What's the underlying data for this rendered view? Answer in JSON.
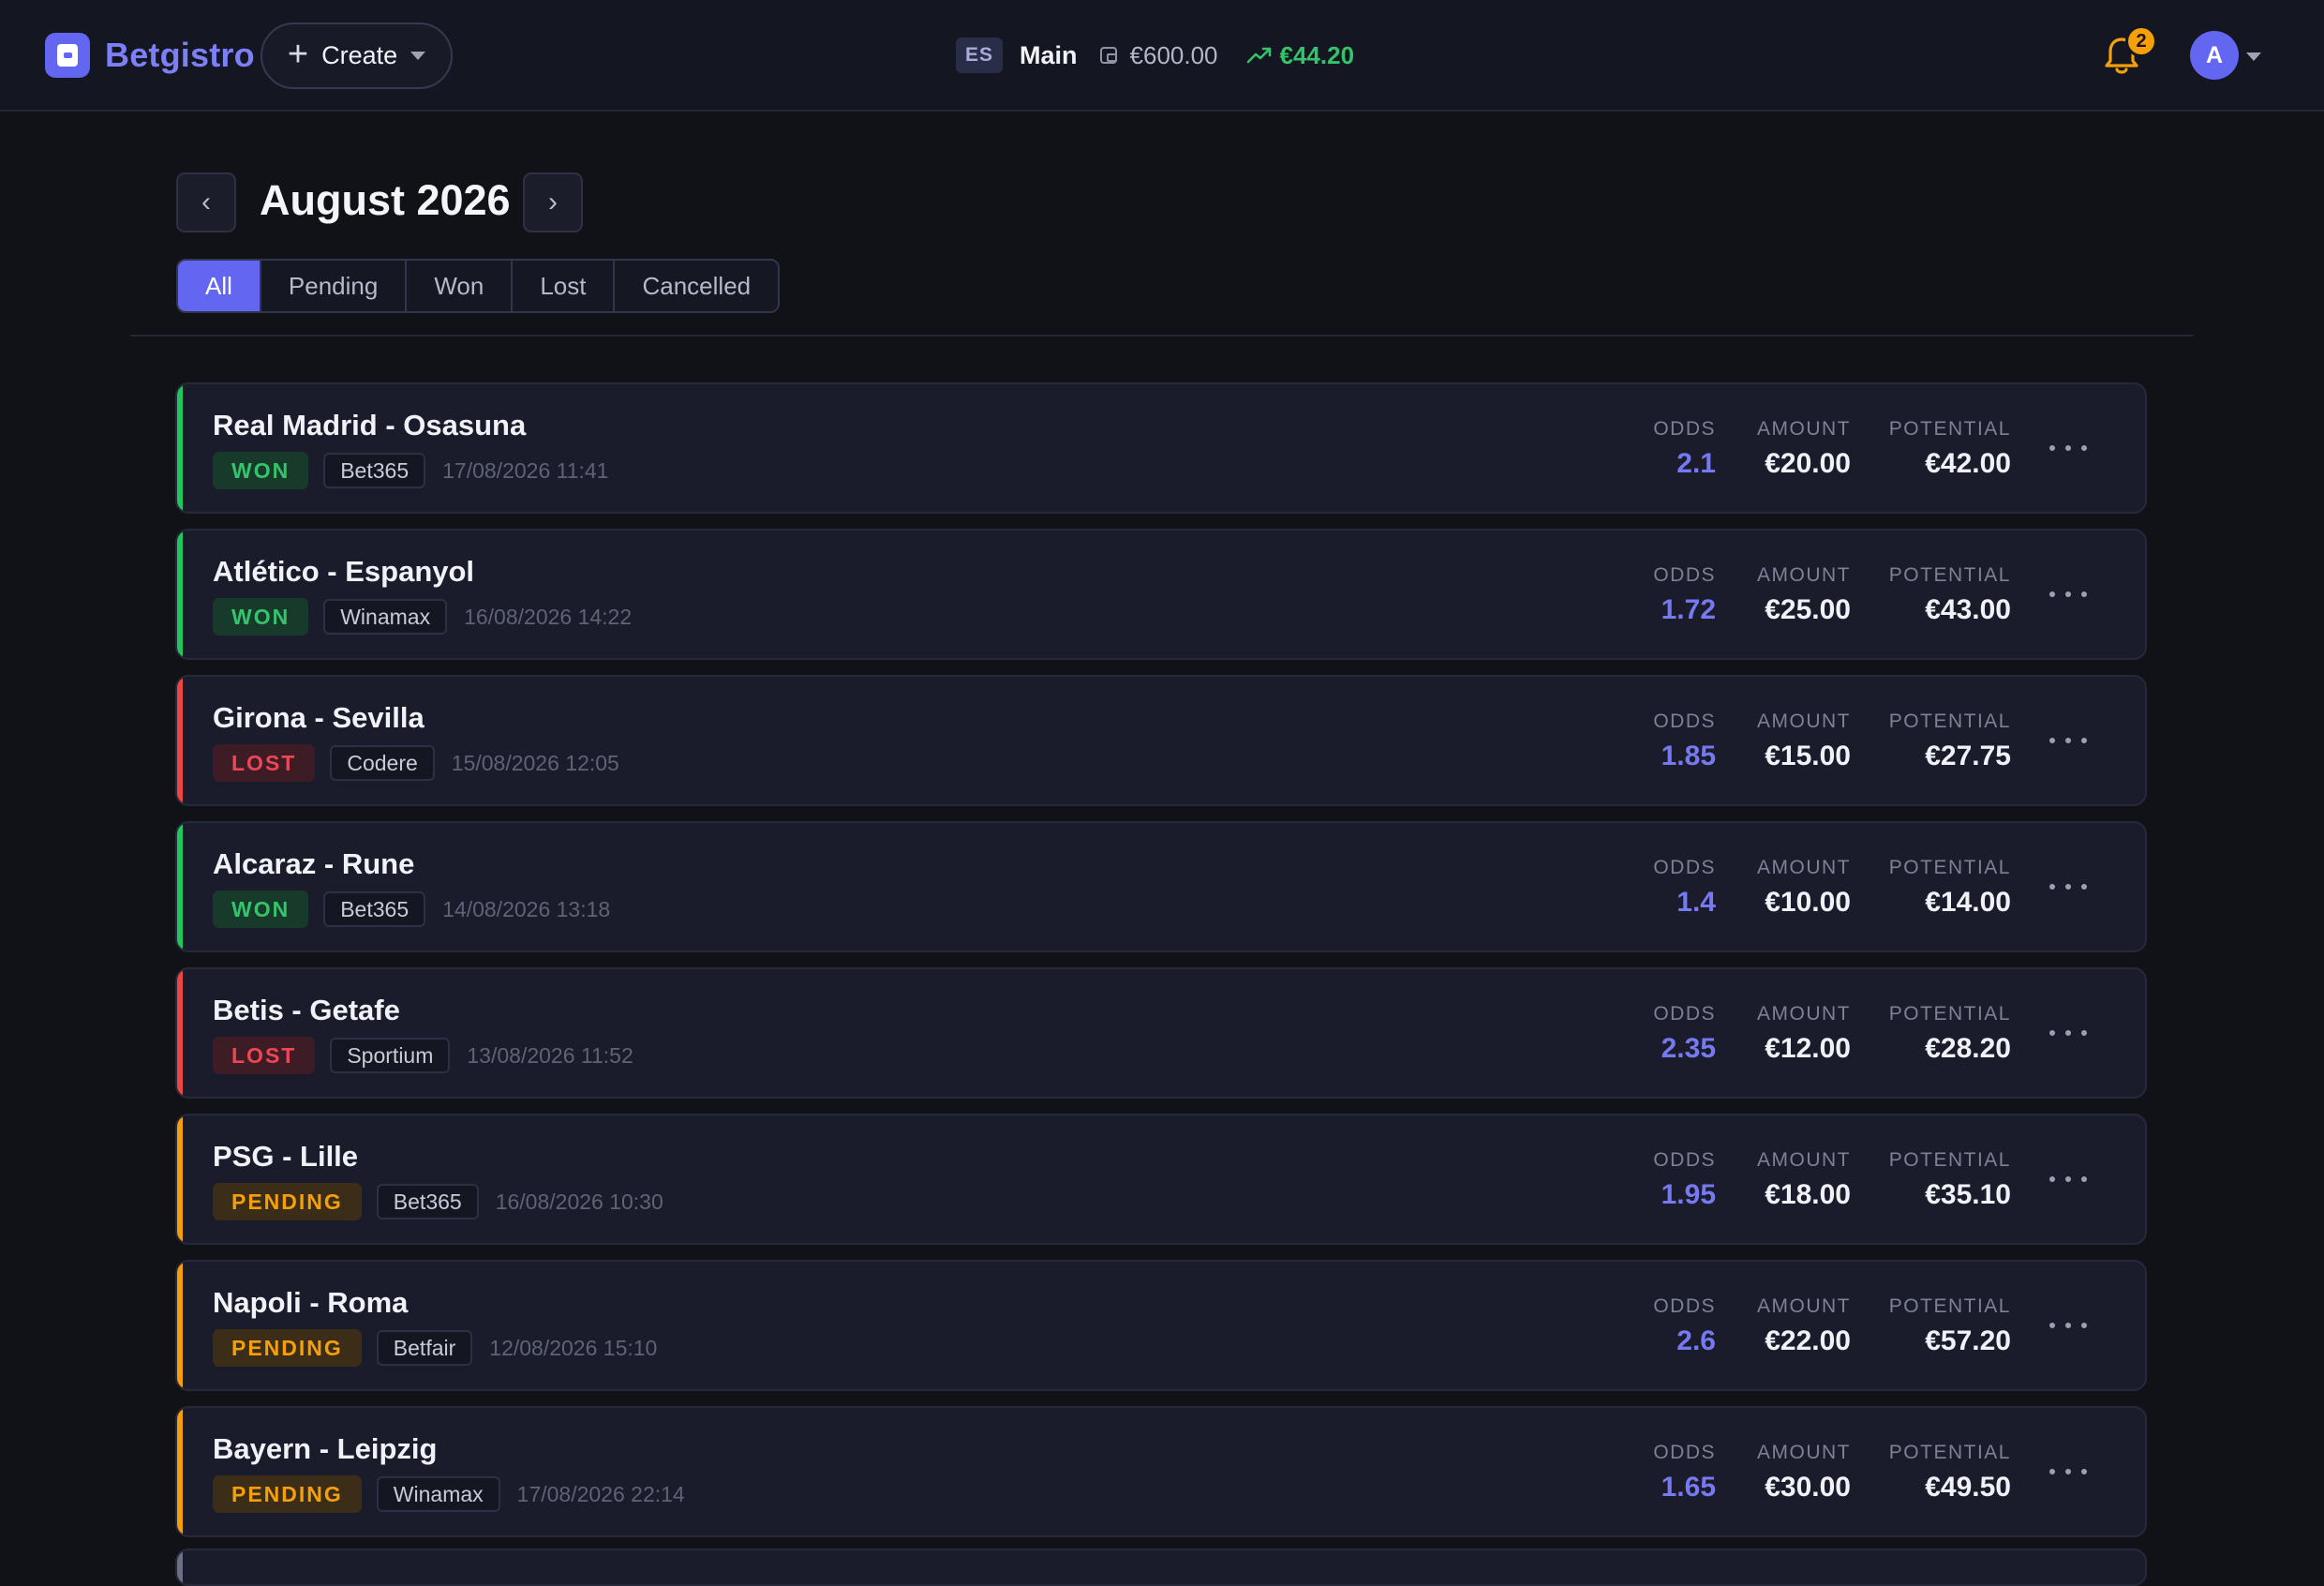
{
  "header": {
    "brand": "Betgistro",
    "create_label": "Create",
    "account_flag": "ES",
    "account_name": "Main",
    "balance": "€600.00",
    "profit": "€44.20",
    "notifications": "2",
    "avatar_initial": "A"
  },
  "month": {
    "title": "August 2026",
    "prev_symbol": "‹",
    "next_symbol": "›"
  },
  "filters": [
    "All",
    "Pending",
    "Won",
    "Lost",
    "Cancelled"
  ],
  "columns": {
    "odds": "ODDS",
    "amount": "AMOUNT",
    "potential": "POTENTIAL"
  },
  "colors": {
    "won": "#22c55e",
    "lost": "#ef4444",
    "pending": "#f59e0b",
    "accent": "#6366f1"
  },
  "bets": [
    {
      "event": "Real Madrid - Osasuna",
      "status": "WON",
      "bookmaker": "Bet365",
      "date": "17/08/2026 11:41",
      "odds": "2.1",
      "amount": "€20.00",
      "potential": "€42.00"
    },
    {
      "event": "Atlético - Espanyol",
      "status": "WON",
      "bookmaker": "Winamax",
      "date": "16/08/2026 14:22",
      "odds": "1.72",
      "amount": "€25.00",
      "potential": "€43.00"
    },
    {
      "event": "Girona - Sevilla",
      "status": "LOST",
      "bookmaker": "Codere",
      "date": "15/08/2026 12:05",
      "odds": "1.85",
      "amount": "€15.00",
      "potential": "€27.75"
    },
    {
      "event": "Alcaraz - Rune",
      "status": "WON",
      "bookmaker": "Bet365",
      "date": "14/08/2026 13:18",
      "odds": "1.4",
      "amount": "€10.00",
      "potential": "€14.00"
    },
    {
      "event": "Betis - Getafe",
      "status": "LOST",
      "bookmaker": "Sportium",
      "date": "13/08/2026 11:52",
      "odds": "2.35",
      "amount": "€12.00",
      "potential": "€28.20"
    },
    {
      "event": "PSG - Lille",
      "status": "PENDING",
      "bookmaker": "Bet365",
      "date": "16/08/2026 10:30",
      "odds": "1.95",
      "amount": "€18.00",
      "potential": "€35.10"
    },
    {
      "event": "Napoli - Roma",
      "status": "PENDING",
      "bookmaker": "Betfair",
      "date": "12/08/2026 15:10",
      "odds": "2.6",
      "amount": "€22.00",
      "potential": "€57.20"
    },
    {
      "event": "Bayern - Leipzig",
      "status": "PENDING",
      "bookmaker": "Winamax",
      "date": "17/08/2026 22:14",
      "odds": "1.65",
      "amount": "€30.00",
      "potential": "€49.50"
    }
  ]
}
